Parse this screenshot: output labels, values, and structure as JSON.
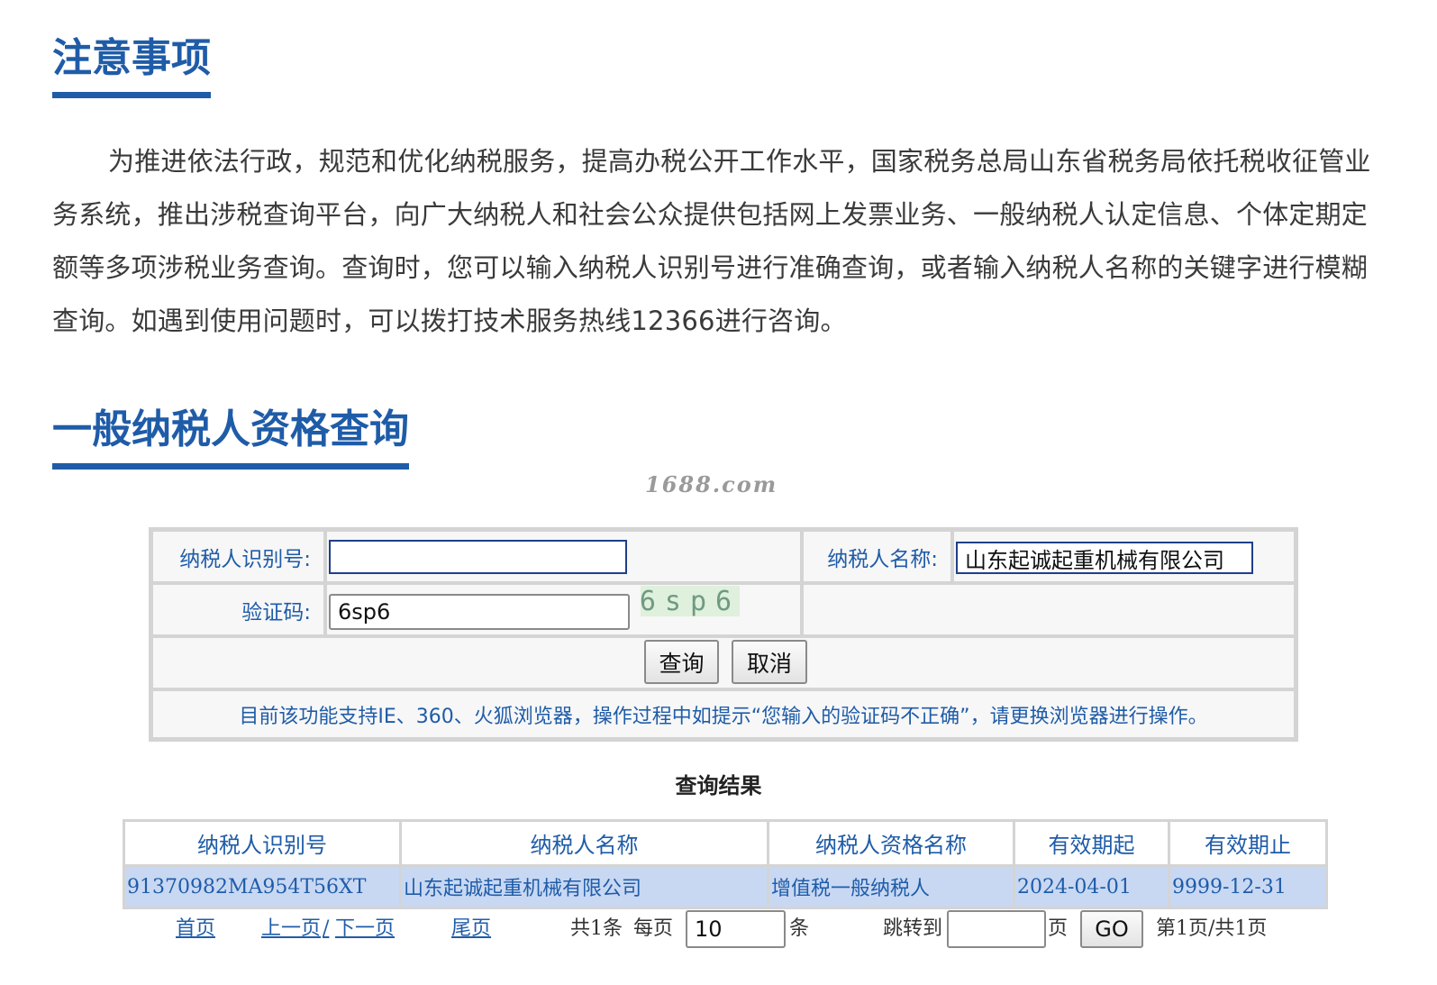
{
  "notice": {
    "title": "注意事项",
    "body": "为推进依法行政，规范和优化纳税服务，提高办税公开工作水平，国家税务总局山东省税务局依托税收征管业务系统，推出涉税查询平台，向广大纳税人和社会公众提供包括网上发票业务、一般纳税人认定信息、个体定期定额等多项涉税业务查询。查询时，您可以输入纳税人识别号进行准确查询，或者输入纳税人名称的关键字进行模糊查询。如遇到使用问题时，可以拨打技术服务热线12366进行咨询。"
  },
  "query": {
    "title": "一般纳税人资格查询",
    "watermark": "1688.com",
    "taxpayer_id_label": "纳税人识别号:",
    "taxpayer_id_value": "",
    "taxpayer_name_label": "纳税人名称:",
    "taxpayer_name_value": "山东起诚起重机械有限公司",
    "captcha_label": "验证码:",
    "captcha_value": "6sp6",
    "captcha_image_text": "6sp6",
    "search_button": "查询",
    "cancel_button": "取消",
    "tip": "目前该功能支持IE、360、火狐浏览器，操作过程中如提示“您输入的验证码不正确”，请更换浏览器进行操作。"
  },
  "results": {
    "title": "查询结果",
    "columns": [
      "纳税人识别号",
      "纳税人名称",
      "纳税人资格名称",
      "有效期起",
      "有效期止"
    ],
    "rows": [
      [
        "91370982MA954T56XT",
        "山东起诚起重机械有限公司",
        "增值税一般纳税人",
        "2024-04-01",
        "9999-12-31"
      ]
    ]
  },
  "pagination": {
    "first": "首页",
    "prev": "上一页",
    "sep": "/",
    "next": "下一页",
    "last": "尾页",
    "total": "共1条",
    "per_page_label": "每页",
    "per_page_value": "10",
    "per_page_unit": "条",
    "jump_label": "跳转到",
    "jump_value": "",
    "jump_unit": "页",
    "go_button": "GO",
    "page_info": "第1页/共1页"
  },
  "colors": {
    "accent": "#1f5ca8",
    "row_highlight": "#c8d8f3",
    "border": "#d4d4d4"
  }
}
